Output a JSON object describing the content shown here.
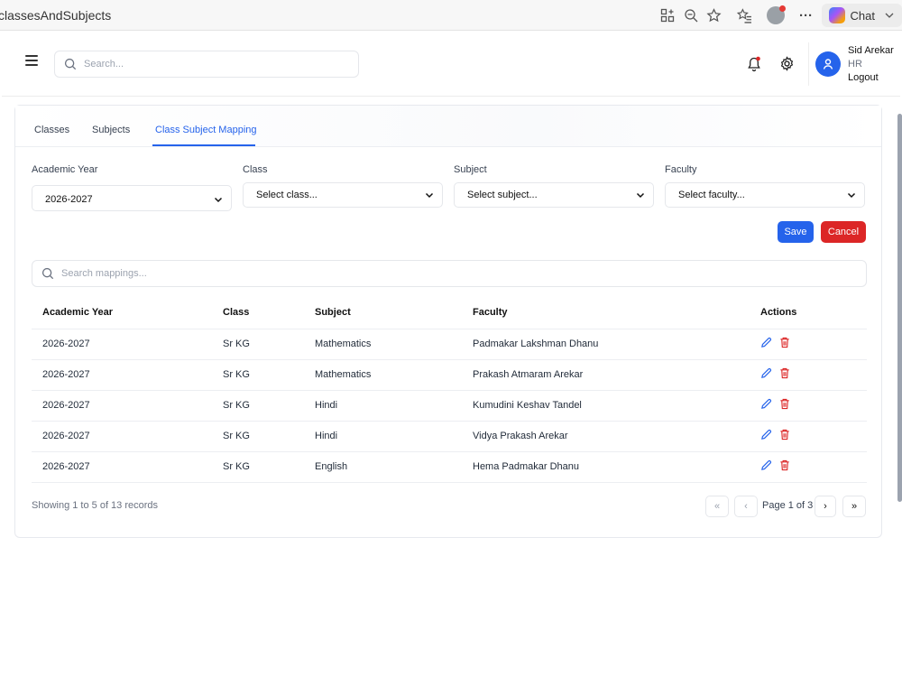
{
  "browser": {
    "url": "classesAndSubjects",
    "chat_label": "Chat"
  },
  "header": {
    "search_placeholder": "Search...",
    "user_name": "Sid Arekar",
    "user_role": "HR",
    "logout_label": "Logout"
  },
  "tabs": [
    "Classes",
    "Subjects",
    "Class Subject Mapping"
  ],
  "active_tab": "Class Subject Mapping",
  "form": {
    "academic_year_label": "Academic Year",
    "academic_year_value": "2026-2027",
    "class_label": "Class",
    "class_value": "Select class...",
    "subject_label": "Subject",
    "subject_value": "Select subject...",
    "faculty_label": "Faculty",
    "faculty_value": "Select faculty...",
    "save_label": "Save",
    "cancel_label": "Cancel"
  },
  "mapping_search_placeholder": "Search mappings...",
  "table": {
    "headers": [
      "Academic Year",
      "Class",
      "Subject",
      "Faculty",
      "Actions"
    ],
    "rows": [
      [
        "2026-2027",
        "Sr KG",
        "Mathematics",
        "Padmakar Lakshman Dhanu"
      ],
      [
        "2026-2027",
        "Sr KG",
        "Mathematics",
        "Prakash Atmaram Arekar"
      ],
      [
        "2026-2027",
        "Sr KG",
        "Hindi",
        "Kumudini Keshav Tandel"
      ],
      [
        "2026-2027",
        "Sr KG",
        "Hindi",
        "Vidya Prakash Arekar"
      ],
      [
        "2026-2027",
        "Sr KG",
        "English",
        "Hema Padmakar Dhanu"
      ]
    ]
  },
  "pagination": {
    "records_text": "Showing 1 to 5 of 13 records",
    "page_label": "Page 1 of 3",
    "first": "«",
    "prev": "‹",
    "next": "›",
    "last": "»"
  },
  "colors": {
    "primary": "#2563eb",
    "danger": "#dc2626"
  }
}
